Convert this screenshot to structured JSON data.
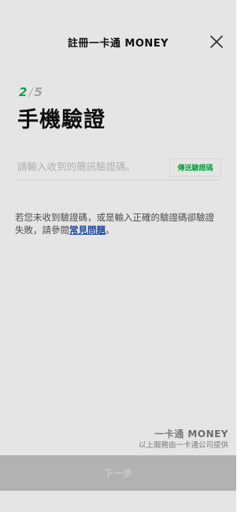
{
  "header": {
    "title": "註冊一卡通 MONEY",
    "close_icon": "close-icon"
  },
  "step": {
    "current": "2",
    "separator": "/",
    "total": "5"
  },
  "page_title": "手機驗證",
  "verification": {
    "placeholder": "請輸入收到的簡訊驗證碼。",
    "value": "",
    "send_button_label": "傳送驗證碼"
  },
  "help": {
    "text_before_link": "若您未收到驗證碼，或是輸入正確的驗證碼卻驗證失敗，請參閱",
    "link_label": "常見問題",
    "text_after_link": "。"
  },
  "branding": {
    "logo_prefix": "一卡通",
    "logo_suffix": "MONEY",
    "note": "以上服務由一卡通公司提供"
  },
  "footer": {
    "next_button_label": "下一步"
  },
  "colors": {
    "accent_green": "#10b54b",
    "link_blue": "#1a4fb5",
    "disabled_button": "#c7c7c7"
  }
}
